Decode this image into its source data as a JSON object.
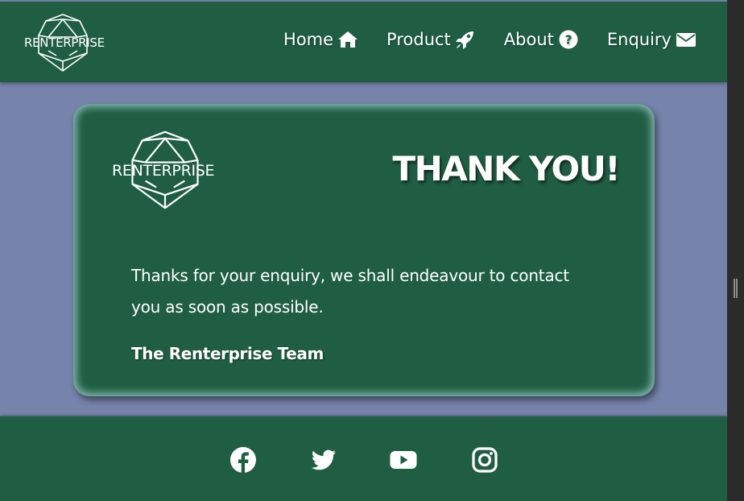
{
  "brand": {
    "name": "RENTERPRISE"
  },
  "nav": {
    "items": [
      {
        "label": "Home",
        "icon": "home-icon"
      },
      {
        "label": "Product",
        "icon": "rocket-icon"
      },
      {
        "label": "About",
        "icon": "question-circle-icon"
      },
      {
        "label": "Enquiry",
        "icon": "envelope-icon"
      }
    ]
  },
  "card": {
    "title": "THANK YOU!",
    "message": "Thanks for your enquiry, we shall endeavour to contact you as soon as possible.",
    "signature": "The Renterprise Team"
  },
  "footer": {
    "social": [
      "facebook-icon",
      "twitter-icon",
      "youtube-icon",
      "instagram-icon"
    ]
  },
  "colors": {
    "primary_green": "#1f5e42",
    "page_background": "#7683ab",
    "card_glow": "#aad7dc",
    "text": "#ffffff"
  }
}
